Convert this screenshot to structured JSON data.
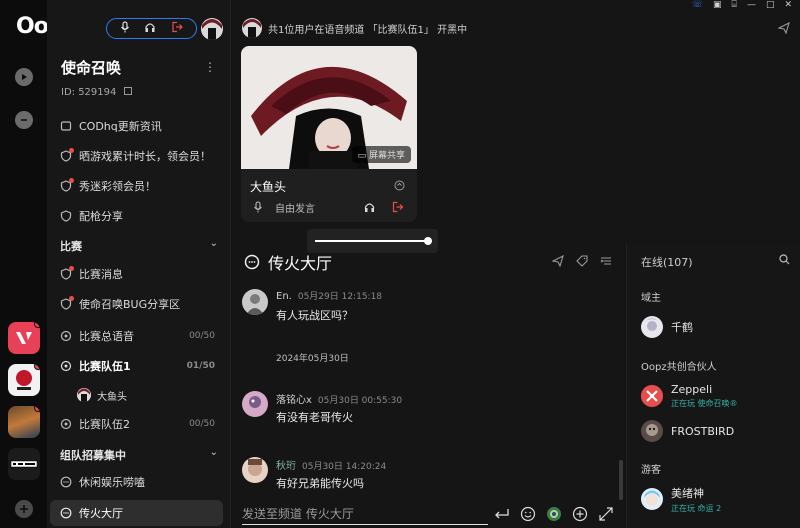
{
  "app": {
    "logo_text": "Oopz."
  },
  "colors": {
    "accent": "#2d7cf6",
    "danger": "#e84d4d",
    "online": "#33b3a6"
  },
  "server": {
    "name": "使命召唤",
    "id_label": "ID: 529194",
    "channels": [
      {
        "label": "CODhq更新资讯",
        "icon": "hash-icon"
      },
      {
        "label": "晒游戏累计时长，领会员！",
        "icon": "shield-icon"
      },
      {
        "label": "秀迷彩领会员！",
        "icon": "shield-icon"
      },
      {
        "label": "配枪分享",
        "icon": "shield-icon"
      }
    ],
    "category_match": "比赛",
    "match_channels": [
      {
        "label": "比赛消息",
        "icon": "shield-icon"
      },
      {
        "label": "使命召唤BUG分享区",
        "icon": "shield-icon"
      },
      {
        "label": "比赛总语音",
        "icon": "voice-icon",
        "count": "00/50"
      },
      {
        "label": "比赛队伍1",
        "icon": "voice-icon",
        "count": "01/50"
      },
      {
        "voice_user": "大鱼头"
      },
      {
        "label": "比赛队伍2",
        "icon": "voice-icon",
        "count": "00/50"
      }
    ],
    "category_team": "组队招募集中",
    "team_channels": [
      {
        "label": "休闲娱乐唠嗑",
        "icon": "chat-icon"
      },
      {
        "label": "传火大厅",
        "icon": "chat-icon",
        "active": true
      }
    ]
  },
  "voice_status": "共1位用户在语音频道 「比赛队伍1」 开黑中",
  "stream": {
    "user": "大鱼头",
    "mode": "自由发言",
    "share_label": "屏幕共享",
    "volume": 1.0
  },
  "channel": {
    "title": "传火大厅",
    "composer_placeholder": "发送至频道 传火大厅"
  },
  "messages": [
    {
      "name": "En.",
      "time": "05月29日 12:15:18",
      "text": "有人玩战区吗？"
    },
    {
      "date_separator": "2024年05月30日"
    },
    {
      "name": "落铭心x",
      "time": "05月30日 00:55:30",
      "text": "有没有老哥传火"
    },
    {
      "name": "秋珩",
      "time": "05月30日 14:20:24",
      "text": "有好兄弟能传火吗"
    }
  ],
  "members": {
    "header": "在线(107)",
    "groups": [
      {
        "title": "域主",
        "items": [
          {
            "name": "千鹤"
          }
        ]
      },
      {
        "title": "Oopz共创合伙人",
        "items": [
          {
            "name": "Zeppeli",
            "status": "正在玩 使命召唤®"
          },
          {
            "name": "FROSTBIRD"
          }
        ]
      },
      {
        "title": "游客",
        "items": [
          {
            "name": "美绪神",
            "status": "正在玩 命运 2"
          }
        ]
      }
    ]
  }
}
